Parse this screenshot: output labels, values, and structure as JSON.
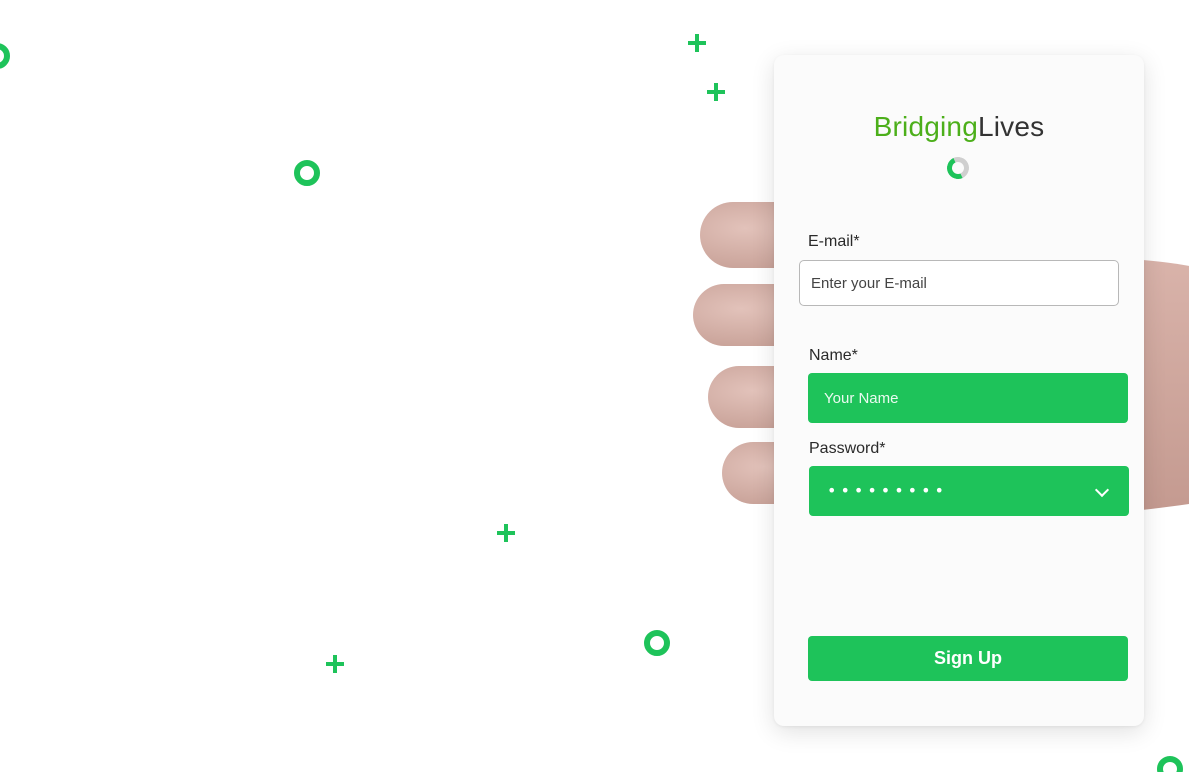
{
  "logo": {
    "green_part": "Bridging",
    "dark_part": "Lives"
  },
  "form": {
    "email": {
      "label": "E-mail*",
      "placeholder": "Enter your E-mail"
    },
    "name": {
      "label": "Name*",
      "placeholder": "Your Name"
    },
    "password": {
      "label": "Password*",
      "value_mask": "•••••••••"
    },
    "submit_label": "Sign Up"
  },
  "colors": {
    "accent_green": "#1ec35a",
    "logo_green": "#4caf1a",
    "logo_dark": "#333333",
    "background": "#ffffff"
  },
  "icons": [
    "ring-decoration-icon",
    "plus-decoration-icon",
    "loading-spinner-icon",
    "chevron-down-icon"
  ]
}
